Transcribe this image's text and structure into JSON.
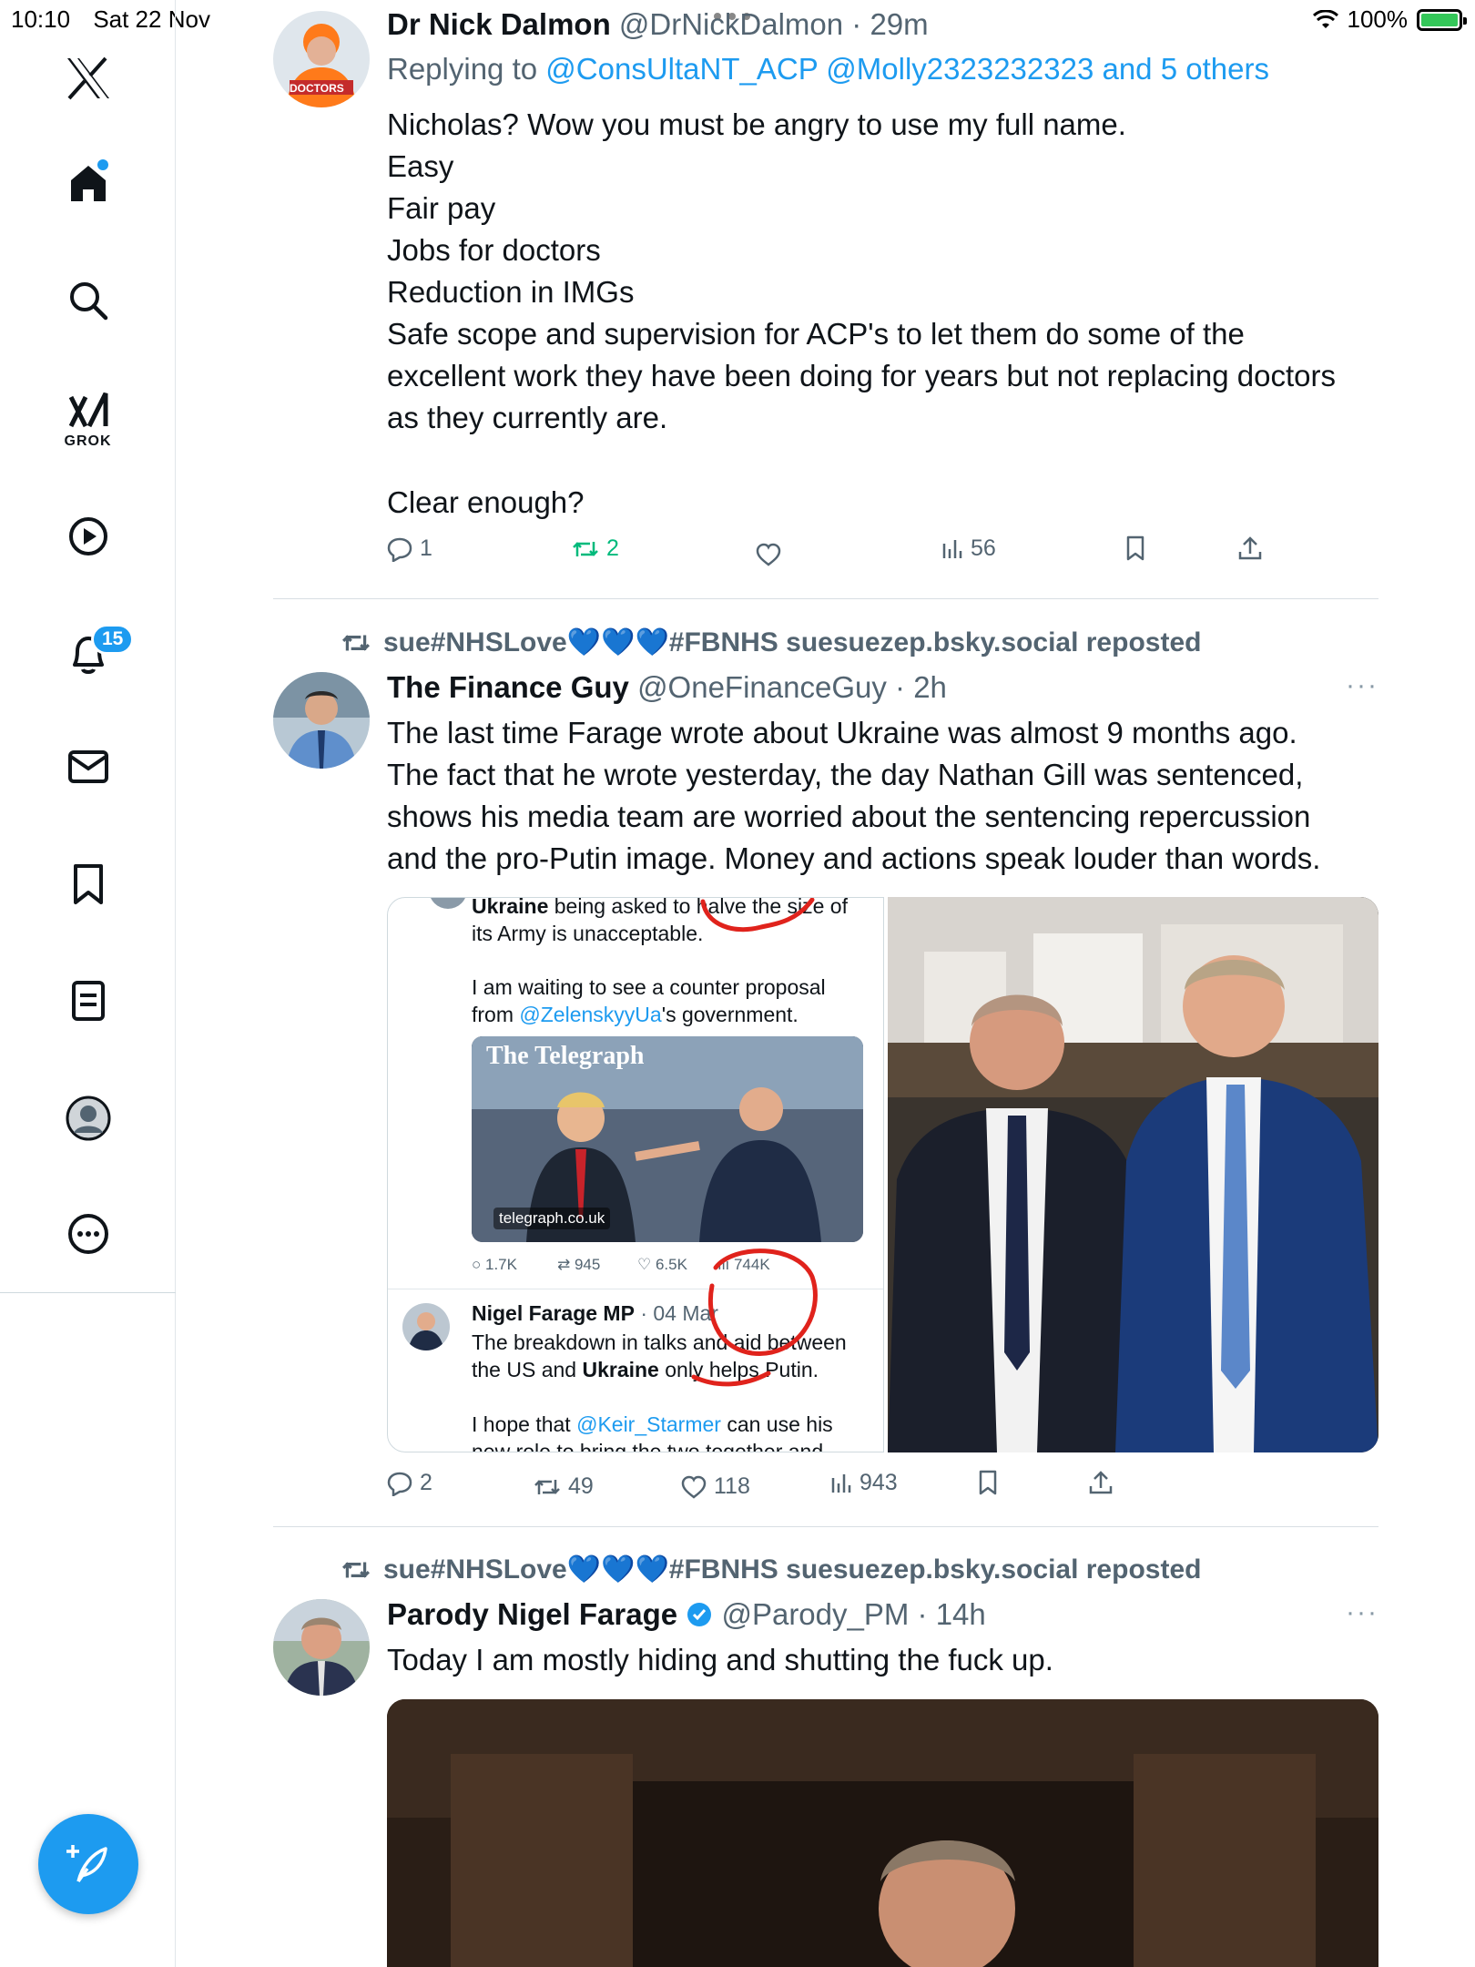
{
  "status": {
    "time": "10:10",
    "date": "Sat 22 Nov",
    "battery": "100%"
  },
  "sidebar": {
    "grok_label": "GROK",
    "notifications_badge": "15"
  },
  "tweet1": {
    "name": "Dr Nick Dalmon",
    "handle": "@DrNickDalmon",
    "time": "· 29m",
    "replying_prefix": "Replying to",
    "replying_to": "@ConsUltaNT_ACP @Molly2323232323 and 5 others",
    "avatar_text": "DOCTORS",
    "lines": [
      "Nicholas? Wow you must be angry to use my full name.",
      "Easy",
      "Fair pay",
      "Jobs for doctors",
      "Reduction in IMGs",
      "Safe scope and supervision for ACP's to let them do some of the",
      "excellent work they have been doing for years but not replacing doctors",
      "as they currently are.",
      "Clear enough?"
    ],
    "replies": "1",
    "reposts": "2",
    "views": "56"
  },
  "tweet2": {
    "reposted_by": "sue#NHSLove💙💙💙#FBNHS suesuezep.bsky.social reposted",
    "name": "The Finance Guy",
    "handle": "@OneFinanceGuy",
    "time": "· 2h",
    "lines": [
      "The last time Farage wrote about Ukraine was almost 9 months ago.",
      "The fact that he wrote yesterday, the day Nathan Gill was sentenced,",
      "shows his media team are worried about the sentencing repercussion",
      "and the pro-Putin image. Money and actions speak louder than words."
    ],
    "embedded": {
      "line1_bold": "Ukraine",
      "line1_rest": " being asked to halve the size of",
      "line2": "its Army is unacceptable.",
      "line3": "I am waiting to see a counter proposal",
      "line4_pre": "from ",
      "line4_link": "@ZelenskyyUa",
      "line4_post": "'s government.",
      "card_title": "The Telegraph",
      "card_domain": "telegraph.co.uk",
      "stat_replies": "1.7K",
      "stat_reposts": "945",
      "stat_likes": "6.5K",
      "stat_views": "744K",
      "quoted_name": "Nigel Farage MP",
      "quoted_time": "· 04 Mar",
      "q_line1": "The breakdown in talks and aid between",
      "q_line2_pre": "the US and ",
      "q_line2_bold": "Ukraine",
      "q_line2_post": " only helps Putin.",
      "q_line3_pre": "I hope that ",
      "q_line3_link": "@Keir_Starmer",
      "q_line3_post": " can use his",
      "q_line4": "new role to bring the two together and"
    },
    "replies": "2",
    "reposts": "49",
    "likes": "118",
    "views": "943"
  },
  "tweet3": {
    "reposted_by": "sue#NHSLove💙💙💙#FBNHS suesuezep.bsky.social reposted",
    "name": "Parody Nigel Farage",
    "handle": "@Parody_PM",
    "time": "· 14h",
    "text": "Today I am mostly hiding and shutting the fuck up."
  },
  "colors": {
    "accent": "#1d9bf0",
    "muted": "#536471",
    "repost_green": "#00ba7c"
  }
}
